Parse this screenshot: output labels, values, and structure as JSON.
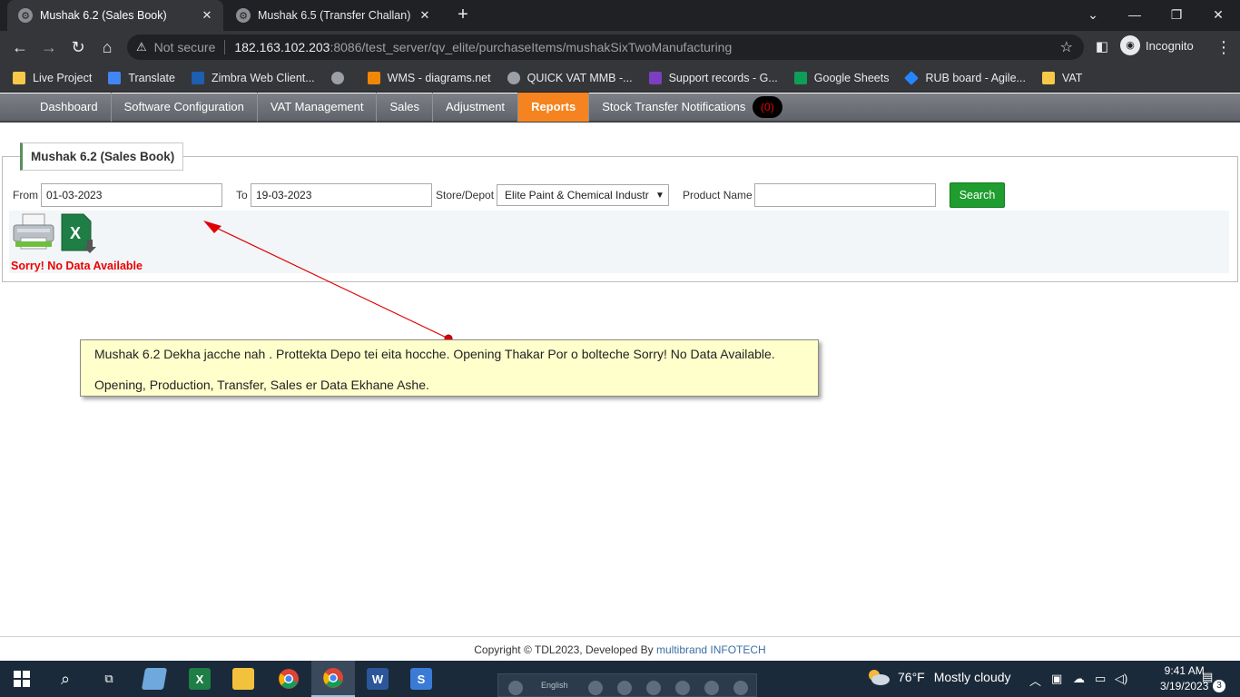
{
  "browser": {
    "tabs": [
      {
        "title": "Mushak 6.2 (Sales Book)",
        "active": true
      },
      {
        "title": "Mushak 6.5 (Transfer Challan)",
        "active": false
      }
    ],
    "new_tab_symbol": "+",
    "address": {
      "security_text": "Not secure",
      "host": "182.163.102.203",
      "path": ":8086/test_server/qv_elite/purchaseItems/mushakSixTwoManufacturing"
    },
    "profile_label": "Incognito",
    "bookmarks": [
      {
        "label": "Live Project",
        "icon": "folder-icon",
        "color": "#f7c948"
      },
      {
        "label": "Translate",
        "icon": "google-translate-icon",
        "color": "#4285f4"
      },
      {
        "label": "Zimbra Web Client...",
        "icon": "zimbra-icon",
        "color": "#1d5fb0"
      },
      {
        "label": "",
        "icon": "globe-icon",
        "color": "#9aa0a6"
      },
      {
        "label": "WMS - diagrams.net",
        "icon": "diagrams-icon",
        "color": "#f08705"
      },
      {
        "label": "QUICK VAT MMB -...",
        "icon": "gear-icon",
        "color": "#9aa0a6"
      },
      {
        "label": "Support records - G...",
        "icon": "forms-icon",
        "color": "#7b3fbf"
      },
      {
        "label": "Google Sheets",
        "icon": "sheets-icon",
        "color": "#0f9d58"
      },
      {
        "label": "RUB board - Agile...",
        "icon": "jira-icon",
        "color": "#2684ff"
      },
      {
        "label": "VAT",
        "icon": "folder-icon",
        "color": "#f7c948"
      }
    ]
  },
  "app_nav": {
    "items": [
      {
        "label": "Dashboard"
      },
      {
        "label": "Software Configuration"
      },
      {
        "label": "VAT Management"
      },
      {
        "label": "Sales"
      },
      {
        "label": "Adjustment"
      },
      {
        "label": "Reports",
        "active": true
      },
      {
        "label": "Stock Transfer Notifications"
      }
    ],
    "notification_count": "(0)"
  },
  "report": {
    "legend": "Mushak 6.2 (Sales Book)",
    "from_label": "From",
    "from_value": "01-03-2023",
    "to_label": "To",
    "to_value": "19-03-2023",
    "store_label": "Store/Depot",
    "store_value": "Elite Paint & Chemical Industr",
    "product_label": "Product Name",
    "product_value": "",
    "search_label": "Search",
    "no_data_text": "Sorry! No Data Available",
    "excel_glyph": "X"
  },
  "annotation": {
    "line1": "Mushak 6.2 Dekha jacche nah . Prottekta Depo tei eita hocche. Opening Thakar Por o bolteche Sorry! No Data Available.",
    "line2": "Opening, Production, Transfer, Sales er Data Ekhane Ashe.",
    "arrow_color": "#e00000"
  },
  "footer": {
    "text": "Copyright © TDL2023, Developed By",
    "developer": "multibrand INFOTECH"
  },
  "taskbar": {
    "apps": [
      "start-icon",
      "search-icon",
      "task-view-icon",
      "notes-icon",
      "excel-icon",
      "file-explorer-icon",
      "chrome-icon",
      "chrome-icon",
      "word-icon",
      "s-app-icon"
    ],
    "language": "English",
    "weather_temp": "76°F",
    "weather_text": "Mostly cloudy",
    "time": "9:41 AM",
    "date": "3/19/2023",
    "notification_badge": "3"
  },
  "colors": {
    "reports_active": "#f58420",
    "search_button": "#1f9d2e",
    "error_text": "#ee0000",
    "annotation_bg": "#ffffcc"
  }
}
